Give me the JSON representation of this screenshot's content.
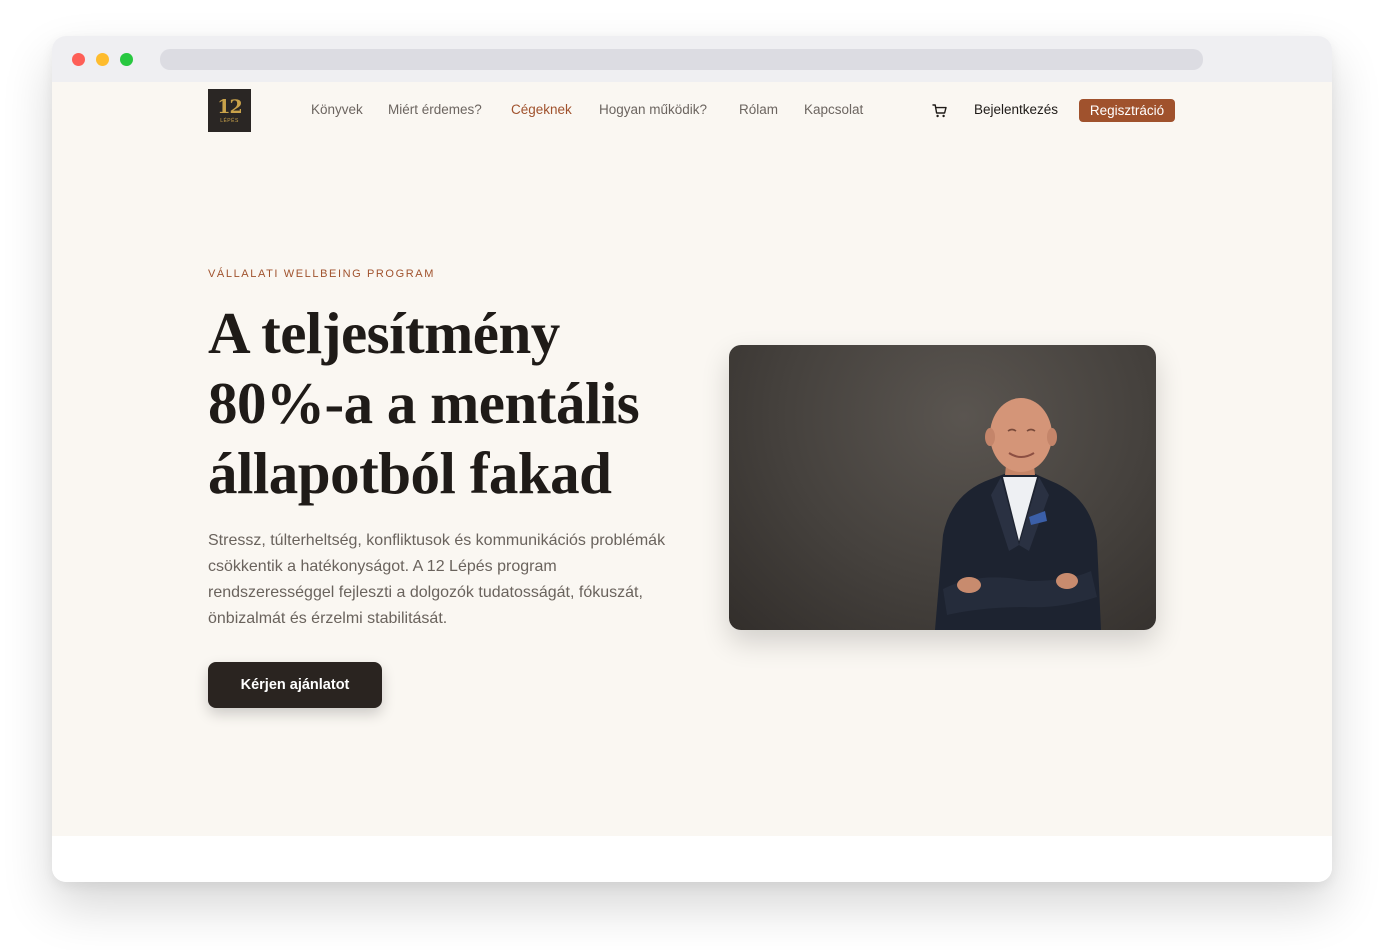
{
  "nav": {
    "logo": {
      "number": "12",
      "subtitle": "LÉPÉS"
    },
    "links": [
      "Könyvek",
      "Miért érdemes?",
      "Cégeknek",
      "Hogyan működik?",
      "Rólam",
      "Kapcsolat"
    ],
    "active_link": "Cégeknek",
    "cart_icon": "cart-icon",
    "login_label": "Bejelentkezés",
    "register_label": "Regisztráció"
  },
  "hero": {
    "eyebrow": "VÁLLALATI WELLBEING PROGRAM",
    "headline_lines": [
      "A teljesítmény",
      "80%-a a mentális",
      "állapotból fakad"
    ],
    "lead": "Stressz, túlterheltség, konfliktusok és kommunikációs problémák csökkentik a hatékonyságot. A 12 Lépés program rendszerességgel fejleszti a dolgozók tudatosságát, fókuszát, önbizalmát és érzelmi stabilitását.",
    "cta_label": "Kérjen ajánlatot",
    "image": "portrait-photo"
  },
  "colors": {
    "accent": "#a0522d",
    "page_bg": "#faf7f2",
    "dark": "#2a2420",
    "heading": "#1f1b18"
  }
}
